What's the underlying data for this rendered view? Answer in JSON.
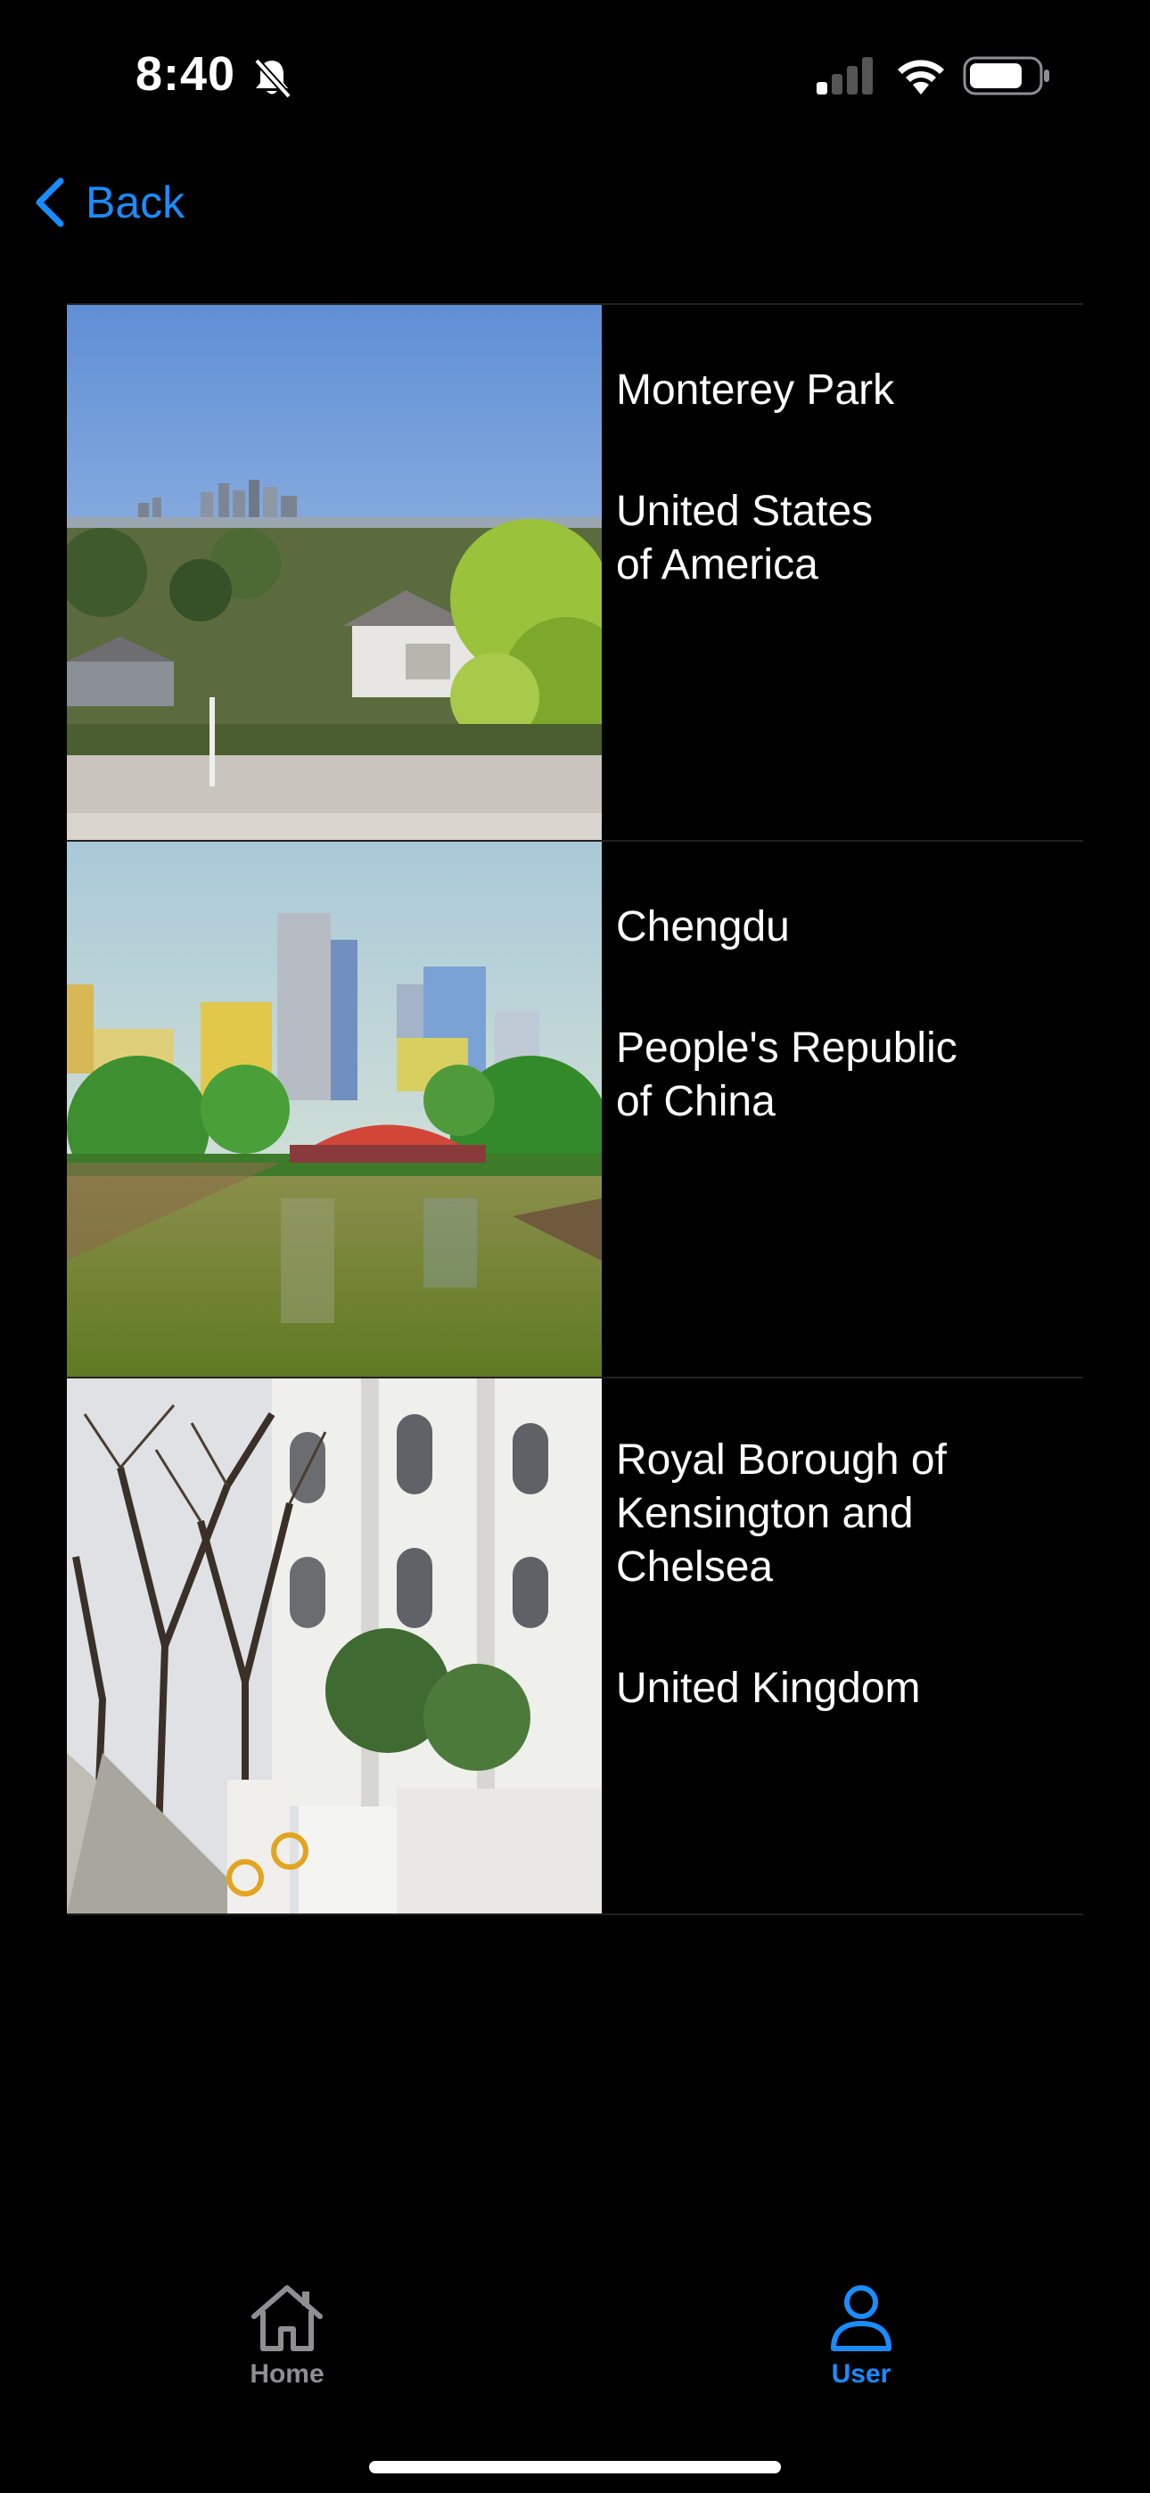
{
  "status_bar": {
    "time": "8:40",
    "icons": [
      "bell-slash-icon",
      "cellular-signal-icon",
      "wifi-icon",
      "battery-icon"
    ]
  },
  "nav": {
    "back_label": "Back",
    "accent_color": "#1a8cff"
  },
  "locations": [
    {
      "city": "Monterey Park",
      "country": "United States\nof America"
    },
    {
      "city": "Chengdu",
      "country": "People's Republic\nof China"
    },
    {
      "city": "Royal Borough of\nKensington and\nChelsea",
      "country": "United Kingdom"
    }
  ],
  "tab_bar": {
    "tabs": [
      {
        "label": "Home",
        "icon": "house-icon",
        "selected": false
      },
      {
        "label": "User",
        "icon": "person-icon",
        "selected": true
      }
    ]
  }
}
